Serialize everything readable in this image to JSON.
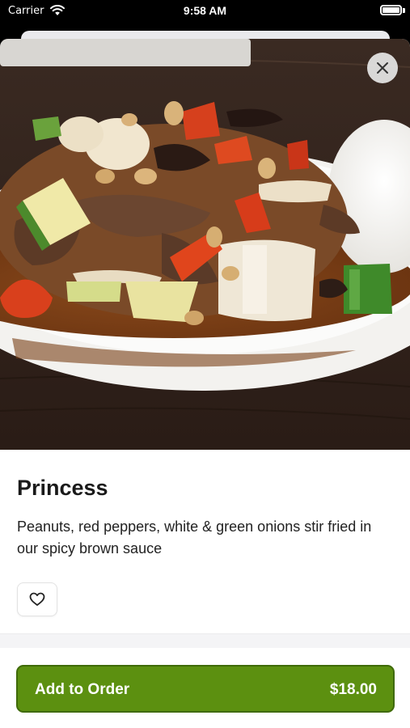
{
  "status_bar": {
    "carrier": "Carrier",
    "time": "9:58 AM",
    "wifi_icon": "wifi-icon",
    "battery_icon": "battery-full-icon"
  },
  "item": {
    "name": "Princess",
    "description": "Peanuts, red peppers, white & green onions stir fried in our spicy brown sauce",
    "photo_icon": "food-photo"
  },
  "actions": {
    "close_icon": "close-icon",
    "favorite_icon": "heart-icon"
  },
  "footer": {
    "add_label": "Add to Order",
    "price": "$18.00"
  },
  "colors": {
    "accent": "#5c9010",
    "accent_border": "#3f6a08"
  }
}
